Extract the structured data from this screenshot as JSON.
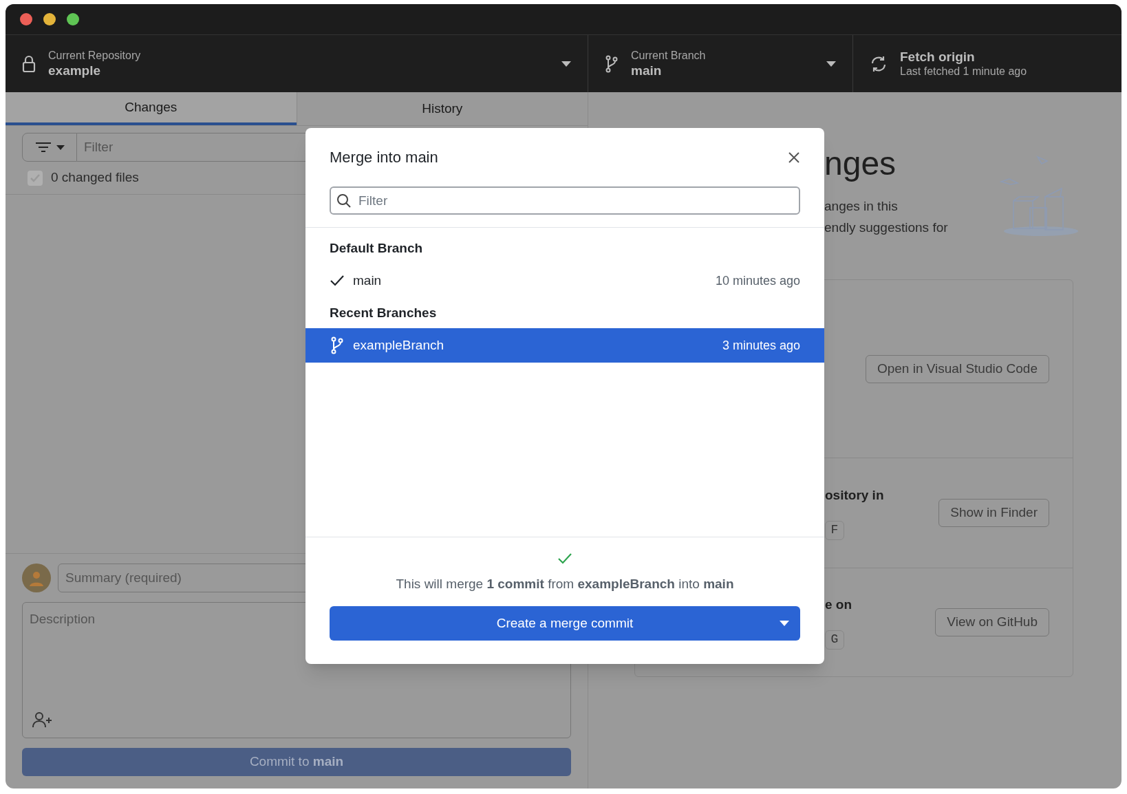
{
  "toolbar": {
    "repository": {
      "label": "Current Repository",
      "value": "example"
    },
    "branch": {
      "label": "Current Branch",
      "value": "main"
    },
    "fetch": {
      "title": "Fetch origin",
      "subtitle": "Last fetched 1 minute ago"
    }
  },
  "tabs": [
    {
      "label": "Changes",
      "selected": true
    },
    {
      "label": "History",
      "selected": false
    }
  ],
  "changes": {
    "filter_placeholder": "Filter",
    "select_all": {
      "label": "0 changed files",
      "checked": true,
      "disabled": true
    }
  },
  "commit": {
    "summary_placeholder": "Summary (required)",
    "description_placeholder": "Description",
    "button": "Commit to **main**",
    "disabled": true
  },
  "background_panel": {
    "title": "nges",
    "text_lines": [
      "anges in this",
      "endly suggestions for"
    ],
    "actions": [
      {
        "button": "Open in Visual Studio Code"
      },
      {
        "title": "ository in",
        "key": "F",
        "button": "Show in Finder"
      },
      {
        "title": "e on",
        "key": "G",
        "button": "View on GitHub"
      }
    ]
  },
  "dialog": {
    "title": "Merge into main",
    "filter_placeholder": "Filter",
    "groups": [
      {
        "heading": "Default Branch",
        "branches": [
          {
            "name": "main",
            "time": "10 minutes ago",
            "current": true,
            "selected": false
          }
        ]
      },
      {
        "heading": "Recent Branches",
        "branches": [
          {
            "name": "exampleBranch",
            "time": "3 minutes ago",
            "current": false,
            "selected": true
          }
        ]
      }
    ],
    "summary": "This will merge **1 commit** from **exampleBranch** into **main**",
    "button": "Create a merge commit"
  }
}
